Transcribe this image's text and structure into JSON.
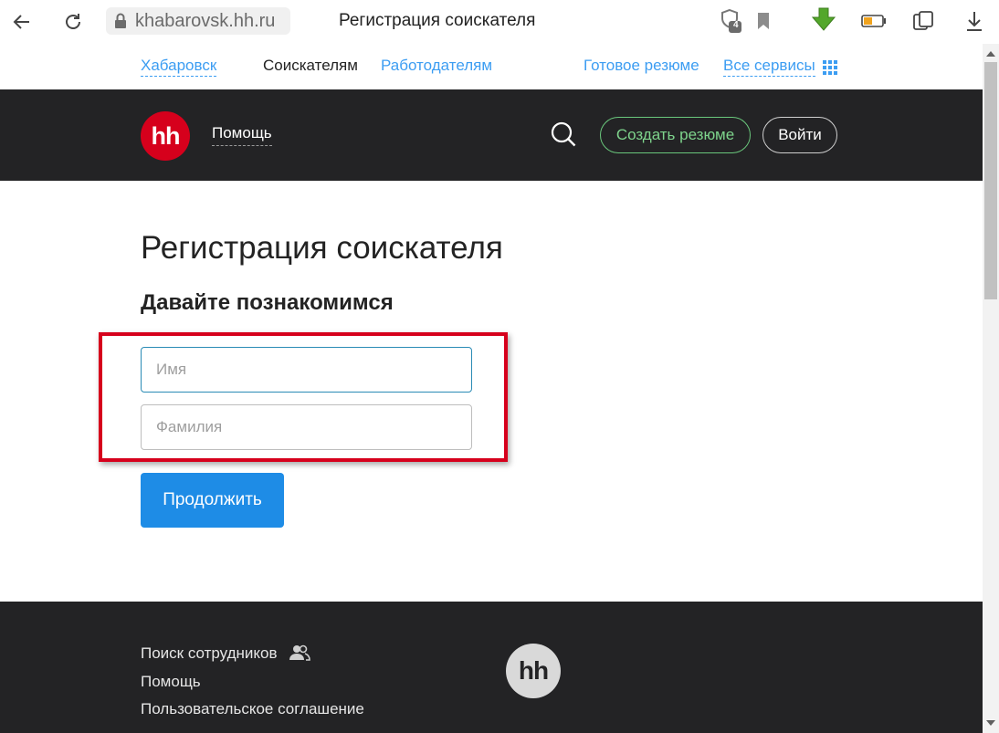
{
  "browser": {
    "url": "khabarovsk.hh.ru",
    "tab_title": "Регистрация соискателя",
    "shield_badge": "4"
  },
  "topbar": {
    "city": "Хабаровск",
    "seekers": "Соискателям",
    "employers": "Работодателям",
    "ready_resume": "Готовое резюме",
    "all_services": "Все сервисы"
  },
  "header": {
    "logo": "hh",
    "help": "Помощь",
    "create_resume": "Создать резюме",
    "login": "Войти"
  },
  "main": {
    "title": "Регистрация соискателя",
    "subtitle": "Давайте познакомимся",
    "first_name_placeholder": "Имя",
    "last_name_placeholder": "Фамилия",
    "continue": "Продолжить"
  },
  "footer": {
    "find_employees": "Поиск сотрудников",
    "help": "Помощь",
    "user_agreement": "Пользовательское соглашение",
    "logo": "hh"
  },
  "colors": {
    "brand_red": "#d6001c",
    "link_blue": "#3c9df2",
    "primary_button": "#1e8ce6",
    "header_bg": "#232325",
    "create_resume_green": "#7ed48c",
    "highlight_red": "#d6001c"
  },
  "icons": [
    "back-icon",
    "reload-icon",
    "lock-icon",
    "shield-icon",
    "bookmark-icon",
    "download-arrow-icon",
    "battery-icon",
    "tabs-icon",
    "download-icon",
    "grid-icon",
    "search-icon",
    "people-icon"
  ]
}
